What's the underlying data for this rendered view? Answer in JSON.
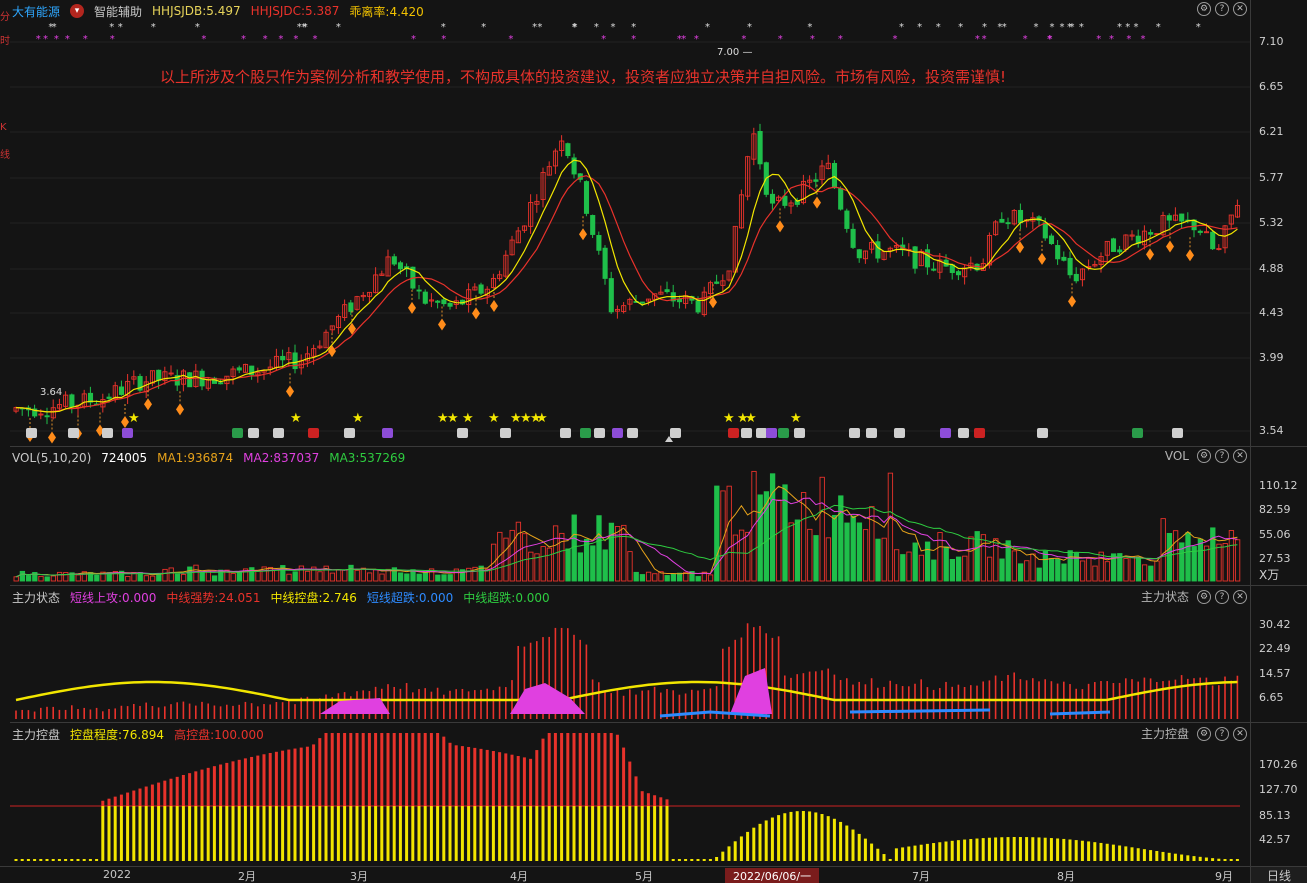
{
  "main": {
    "stock_name": "大有能源",
    "assist_label": "智能辅助",
    "indicators": [
      {
        "label": "HHJSJDB:5.497",
        "color": "#e6d35a"
      },
      {
        "label": "HHJSJDC:5.387",
        "color": "#e8322b"
      },
      {
        "label": "乖离率:4.420",
        "color": "#f2c200"
      }
    ],
    "disclaimer": "以上所涉及个股只作为案例分析和教学使用，不构成具体的投资建议，投资者应独立决策并自担风险。市场有风险，投资需谨慎!",
    "axis_labels": [
      "7.10",
      "6.65",
      "6.21",
      "5.77",
      "5.32",
      "4.88",
      "4.43",
      "3.99",
      "3.54"
    ],
    "high_label": "7.00",
    "low_label": "3.64"
  },
  "left_edge": [
    "分",
    "时",
    "K",
    "线"
  ],
  "vol": {
    "title": "VOL(5,10,20)",
    "value": "724005",
    "ma1": "MA1:936874",
    "ma2": "MA2:837037",
    "ma3": "MA3:537269",
    "name": "VOL",
    "axis_labels": [
      "110.12",
      "82.59",
      "55.06",
      "27.53"
    ],
    "unit": "X万"
  },
  "zlzt": {
    "title": "主力状态",
    "items": [
      {
        "label": "短线上攻:0.000",
        "color": "#e040e0"
      },
      {
        "label": "中线强势:24.051",
        "color": "#e8322b"
      },
      {
        "label": "中线控盘:2.746",
        "color": "#f2e600"
      },
      {
        "label": "短线超跌:0.000",
        "color": "#2e8bff"
      },
      {
        "label": "中线超跌:0.000",
        "color": "#2ecc40"
      }
    ],
    "name": "主力状态",
    "axis_labels": [
      "30.42",
      "22.49",
      "14.57",
      "6.65"
    ]
  },
  "zlkp": {
    "title": "主力控盘",
    "items": [
      {
        "label": "控盘程度:76.894",
        "color": "#f2e600"
      },
      {
        "label": "高控盘:100.000",
        "color": "#e8322b"
      }
    ],
    "name": "主力控盘",
    "axis_labels": [
      "170.26",
      "127.70",
      "85.13",
      "42.57"
    ]
  },
  "xaxis": {
    "labels": [
      "2022",
      "2月",
      "3月",
      "4月",
      "5月",
      "7月",
      "8月",
      "9月"
    ],
    "cursor_date": "2022/06/06/一",
    "day_button": "日线"
  },
  "colors": {
    "up": "#e8322b",
    "down": "#1fbf4a",
    "bg": "#141414",
    "yellow": "#f2e600",
    "magenta": "#e040e0"
  },
  "icons": [
    "settings-icon",
    "help-icon",
    "close-icon",
    "dropdown-icon"
  ]
}
